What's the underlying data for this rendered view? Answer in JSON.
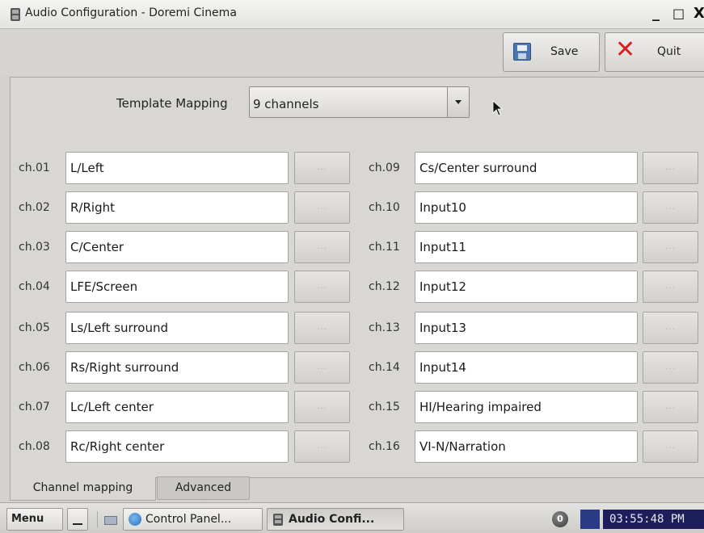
{
  "window": {
    "title": "Audio Configuration - Doremi Cinema",
    "minimize": "_",
    "maximize": "□",
    "close": "X"
  },
  "toolbar": {
    "save_label": "Save",
    "quit_label": "Quit"
  },
  "template": {
    "label": "Template Mapping",
    "value": "9 channels"
  },
  "channels_left": [
    {
      "id": "ch.01",
      "value": "L/Left"
    },
    {
      "id": "ch.02",
      "value": "R/Right"
    },
    {
      "id": "ch.03",
      "value": "C/Center"
    },
    {
      "id": "ch.04",
      "value": "LFE/Screen"
    },
    {
      "id": "ch.05",
      "value": "Ls/Left surround"
    },
    {
      "id": "ch.06",
      "value": "Rs/Right surround"
    },
    {
      "id": "ch.07",
      "value": "Lc/Left center"
    },
    {
      "id": "ch.08",
      "value": "Rc/Right center"
    }
  ],
  "channels_right": [
    {
      "id": "ch.09",
      "value": "Cs/Center surround"
    },
    {
      "id": "ch.10",
      "value": "Input10"
    },
    {
      "id": "ch.11",
      "value": "Input11"
    },
    {
      "id": "ch.12",
      "value": "Input12"
    },
    {
      "id": "ch.13",
      "value": "Input13"
    },
    {
      "id": "ch.14",
      "value": "Input14"
    },
    {
      "id": "ch.15",
      "value": "HI/Hearing impaired"
    },
    {
      "id": "ch.16",
      "value": "VI-N/Narration"
    }
  ],
  "browse_label": "...",
  "tabs": {
    "channel_mapping": "Channel mapping",
    "advanced": "Advanced"
  },
  "taskbar": {
    "menu": "Menu",
    "control_panel": "Control Panel...",
    "audio_config": "Audio Confi...",
    "tray_badge": "0",
    "clock": "03:55:48 PM"
  }
}
